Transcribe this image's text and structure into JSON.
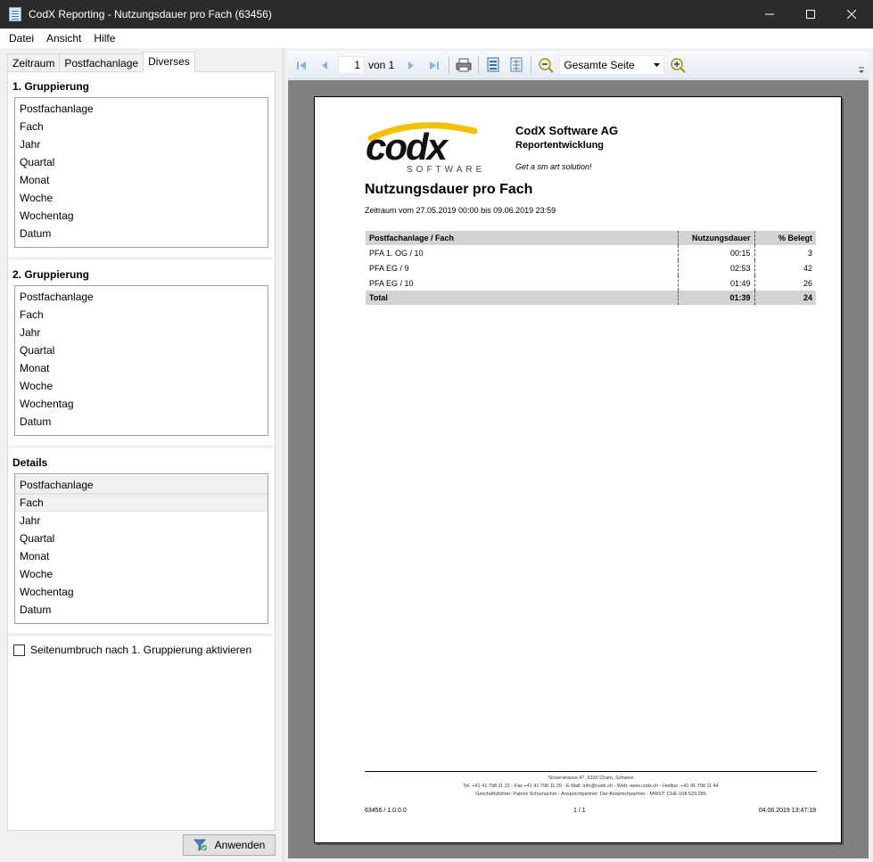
{
  "window": {
    "title": "CodX Reporting - Nutzungsdauer pro Fach (63456)",
    "minimize": "—",
    "maximize": "☐",
    "close": "✕"
  },
  "menu": [
    "Datei",
    "Ansicht",
    "Hilfe"
  ],
  "tabs": [
    "Zeitraum",
    "Postfachanlage",
    "Diverses"
  ],
  "active_tab": "Diverses",
  "grouping1": {
    "title": "1. Gruppierung",
    "items": [
      "Postfachanlage",
      "Fach",
      "Jahr",
      "Quartal",
      "Monat",
      "Woche",
      "Wochentag",
      "Datum"
    ]
  },
  "grouping2": {
    "title": "2. Gruppierung",
    "items": [
      "Postfachanlage",
      "Fach",
      "Jahr",
      "Quartal",
      "Monat",
      "Woche",
      "Wochentag",
      "Datum"
    ]
  },
  "details": {
    "title": "Details",
    "items": [
      "Postfachanlage",
      "Fach",
      "Jahr",
      "Quartal",
      "Monat",
      "Woche",
      "Wochentag",
      "Datum"
    ],
    "selected": [
      "Postfachanlage",
      "Fach"
    ]
  },
  "page_break": {
    "label": "Seitenumbruch nach 1. Gruppierung aktivieren",
    "checked": false
  },
  "apply_button": "Anwenden",
  "toolbar": {
    "page_current": "1",
    "page_of": "von 1",
    "zoom": "Gesamte Seite"
  },
  "report": {
    "company": "CodX Software AG",
    "department": "Reportentwicklung",
    "slogan": "Get a sm art solution!",
    "logo_text": "codx",
    "logo_sub": "SOFTWARE",
    "title": "Nutzungsdauer pro Fach",
    "range": "Zeitraum vom 27.05.2019 00:00 bis 09.06.2019 23:59",
    "columns": [
      "Postfachanlage / Fach",
      "Nutzungsdauer",
      "% Belegt"
    ],
    "rows": [
      [
        "PFA 1. OG / 10",
        "00:15",
        "3"
      ],
      [
        "PFA EG / 9",
        "02:53",
        "42"
      ],
      [
        "PFA EG / 10",
        "01:49",
        "26"
      ]
    ],
    "total": [
      "Total",
      "01:39",
      "24"
    ],
    "footer_address": "Sinserstrasse 47, 6330 Cham, Schweiz",
    "footer_contact": "Tel. +41 41 798 11 22 - Fax +41 41 798 11 29 - E-Mail: info@codx.ch - Web: www.codx.ch - Hotline: +41 41 798 11 44",
    "footer_management": "Geschäftsführer: Patrick Schumacher - Ansprechpartner: Der Ansprechpartner - MWST: CHE-108.529.285",
    "footer_version": "63456 / 1.0.0.0",
    "footer_page": "1 / 1",
    "footer_date": "04.06.2019 13:47:19"
  }
}
